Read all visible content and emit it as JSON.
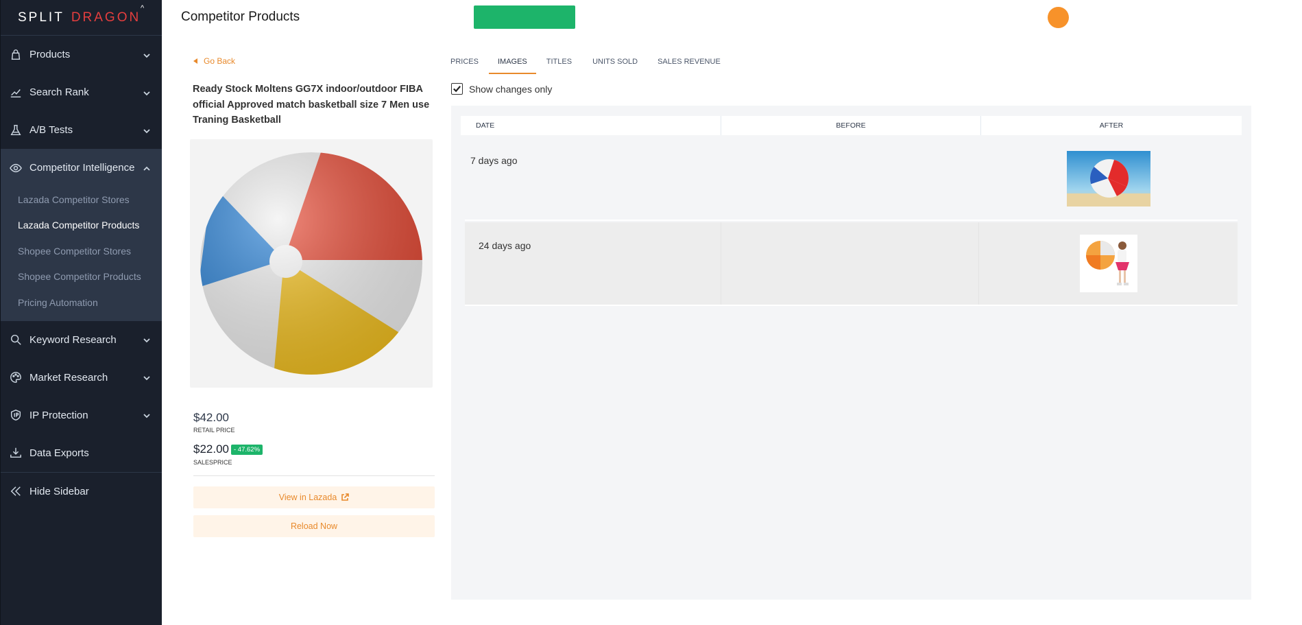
{
  "logo": {
    "split": "SPLIT",
    "dragon": "DRAGON"
  },
  "sidebar": {
    "items": [
      {
        "label": "Products",
        "icon": "bag-icon"
      },
      {
        "label": "Search Rank",
        "icon": "chart-line-icon"
      },
      {
        "label": "A/B Tests",
        "icon": "flask-icon"
      },
      {
        "label": "Competitor Intelligence",
        "icon": "eye-icon"
      },
      {
        "label": "Keyword Research",
        "icon": "search-icon"
      },
      {
        "label": "Market Research",
        "icon": "palette-icon"
      },
      {
        "label": "IP Protection",
        "icon": "shield-icon"
      },
      {
        "label": "Data Exports",
        "icon": "download-icon"
      }
    ],
    "subitems": [
      "Lazada Competitor Stores",
      "Lazada Competitor Products",
      "Shopee Competitor Stores",
      "Shopee Competitor Products",
      "Pricing Automation"
    ],
    "hide_label": "Hide Sidebar"
  },
  "header": {
    "title": "Competitor Products"
  },
  "product": {
    "go_back": "Go Back",
    "title": "Ready Stock Moltens GG7X indoor/outdoor FIBA official Approved match basketball size 7 Men use Traning Basketball",
    "retail_price": "$42.00",
    "retail_label": "RETAIL PRICE",
    "sale_price": "$22.00",
    "discount": "- 47.62%",
    "sale_label": "SALESPRICE",
    "view_label": "View in Lazada",
    "reload_label": "Reload Now"
  },
  "tabs": [
    "PRICES",
    "IMAGES",
    "TITLES",
    "UNITS SOLD",
    "SALES REVENUE"
  ],
  "show_changes": "Show changes only",
  "table": {
    "columns": [
      "DATE",
      "BEFORE",
      "AFTER"
    ],
    "rows": [
      {
        "date": "7 days ago"
      },
      {
        "date": "24 days ago"
      }
    ]
  },
  "colors": {
    "sidebar": "#1a202c",
    "accent": "#e8892b",
    "green": "#1db46a",
    "avatar": "#f7922a"
  }
}
